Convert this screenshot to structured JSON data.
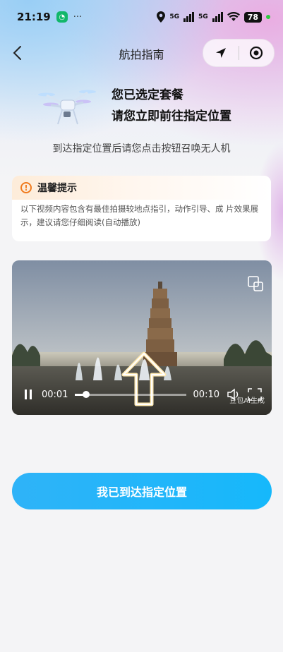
{
  "status_bar": {
    "time": "21:19",
    "battery": "78",
    "signal1": "5G",
    "signal2": "5G"
  },
  "nav": {
    "title": "航拍指南"
  },
  "hero": {
    "line1": "您已选定套餐",
    "line2": "请您立即前往指定位置"
  },
  "subtitle": "到达指定位置后请您点击按钮召唤无人机",
  "notice": {
    "title": "温馨提示",
    "body": "以下视频内容包含有最佳拍摄较地点指引，动作引导、成 片效果展示，建议请您仔细阅读(自动播放)"
  },
  "video": {
    "current_time": "00:01",
    "duration": "00:10",
    "progress": 0.1,
    "watermark": "豆包AI生成"
  },
  "cta": {
    "label": "我已到达指定位置",
    "color": "#16b8fb"
  }
}
